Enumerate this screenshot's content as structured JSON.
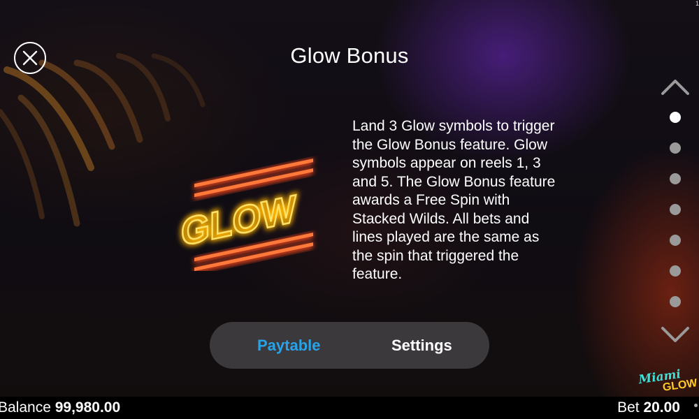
{
  "screen": {
    "title": "Glow Bonus",
    "description": "Land 3 Glow symbols to trigger the Glow Bonus feature. Glow symbols appear on reels 1, 3 and 5. The Glow Bonus feature awards a Free Spin with Stacked Wilds. All bets and lines played are the same as the spin that triggered the feature.",
    "symbol_text": "GLOW"
  },
  "pager": {
    "page_count": 7,
    "active_page": 1
  },
  "tabs": [
    {
      "label": "Paytable",
      "active": true
    },
    {
      "label": "Settings",
      "active": false
    }
  ],
  "logo": {
    "text_top": "Miami",
    "text_bottom": "GLOW"
  },
  "status": {
    "balance_label": "Balance",
    "balance_value": "99,980.00",
    "bet_label": "Bet",
    "bet_value": "20.00",
    "corner_mark": "1"
  },
  "colors": {
    "active_tab": "#29a3e8",
    "glow_yellow": "#ffd34a",
    "glow_red": "#ff4a1c"
  },
  "icons": {
    "close": "close-icon",
    "page_up": "chevron-up-icon",
    "page_down": "chevron-down-icon"
  }
}
